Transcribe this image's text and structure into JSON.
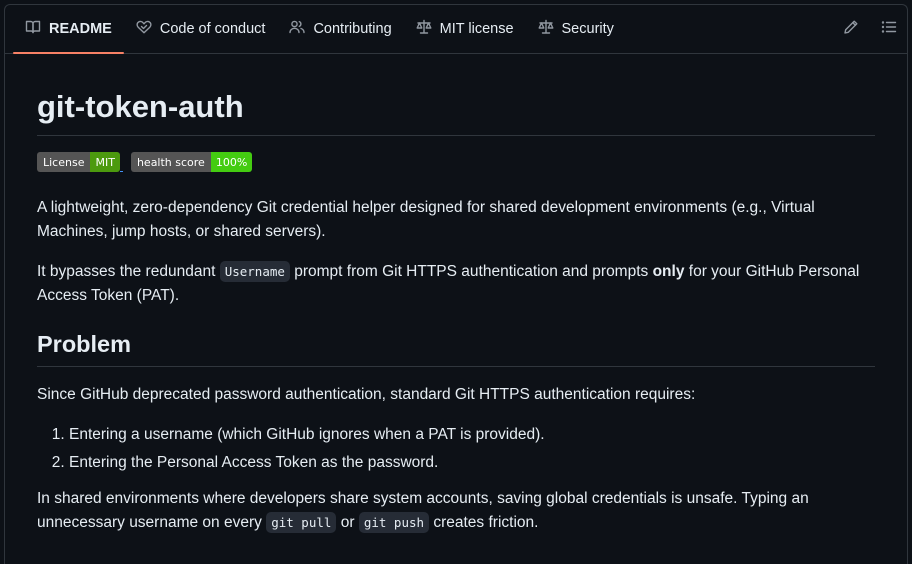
{
  "tabs": [
    {
      "label": "README",
      "icon": "book-icon"
    },
    {
      "label": "Code of conduct",
      "icon": "heart-handshake-icon"
    },
    {
      "label": "Contributing",
      "icon": "people-icon"
    },
    {
      "label": "MIT license",
      "icon": "law-scale-icon"
    },
    {
      "label": "Security",
      "icon": "law-scale-icon"
    }
  ],
  "actions": {
    "edit": "pencil-icon",
    "outline": "list-icon"
  },
  "readme": {
    "title": "git-token-auth",
    "badges": [
      {
        "label": "License",
        "value": "MIT",
        "color": "#4c9a0e"
      },
      {
        "label": "health score",
        "value": "100%",
        "color": "#44cc11"
      }
    ],
    "intro": "A lightweight, zero-dependency Git credential helper designed for shared development environments (e.g., Virtual Machines, jump hosts, or shared servers).",
    "bypass": {
      "before": "It bypasses the redundant ",
      "code": "Username",
      "middle": " prompt from Git HTTPS authentication and prompts ",
      "bold": "only",
      "after": " for your GitHub Personal Access Token (PAT)."
    },
    "problem_heading": "Problem",
    "problem_text": "Since GitHub deprecated password authentication, standard Git HTTPS authentication requires:",
    "steps": [
      "Entering a username (which GitHub ignores when a PAT is provided).",
      "Entering the Personal Access Token as the password."
    ],
    "shared": {
      "before": "In shared environments where developers share system accounts, saving global credentials is unsafe. Typing an unnecessary username on every ",
      "code1": "git pull",
      "middle": " or ",
      "code2": "git push",
      "after": " creates friction."
    }
  }
}
